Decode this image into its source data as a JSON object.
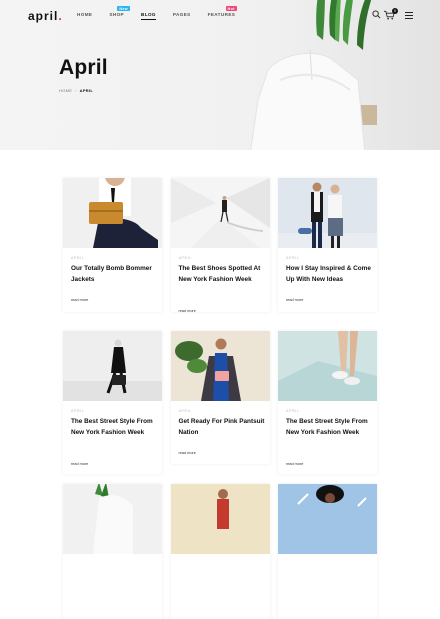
{
  "header": {
    "logo": "april",
    "logo_dot": ".",
    "nav": [
      {
        "label": "HOME",
        "active": false
      },
      {
        "label": "SHOP",
        "active": false,
        "badge": "New",
        "badge_color": "#2bb6f0"
      },
      {
        "label": "BLOG",
        "active": true
      },
      {
        "label": "PAGES",
        "active": false
      },
      {
        "label": "FEATURES",
        "active": false,
        "badge": "Hot",
        "badge_color": "#f0487a"
      }
    ],
    "cart_count": "0"
  },
  "hero": {
    "title": "April",
    "breadcrumb": {
      "home": "HOME",
      "separator": "/",
      "current": "APRIL"
    }
  },
  "posts": [
    {
      "tag": "APRIL",
      "title": "Our Totally Bomb Bommer Jackets",
      "read_more": "read more"
    },
    {
      "tag": "APRIL",
      "title": "The Best Shoes Spotted At New York Fashion Week",
      "read_more": "read more"
    },
    {
      "tag": "APRIL",
      "title": "How I Stay Inspired & Come Up With New Ideas",
      "read_more": "read more"
    },
    {
      "tag": "APRIL",
      "title": "The Best Street Style From New York Fashion Week",
      "read_more": "read more"
    },
    {
      "tag": "APRIL",
      "title": "Get Ready For Pink Pantsuit Nation",
      "read_more": "read more"
    },
    {
      "tag": "APRIL",
      "title": "The Best Street Style From New York Fashion Week",
      "read_more": "read more"
    }
  ],
  "colors": {
    "accent": "#e0314b",
    "text": "#111111",
    "muted": "#bbbbbb"
  },
  "icons": [
    "search-icon",
    "cart-icon",
    "menu-icon"
  ]
}
